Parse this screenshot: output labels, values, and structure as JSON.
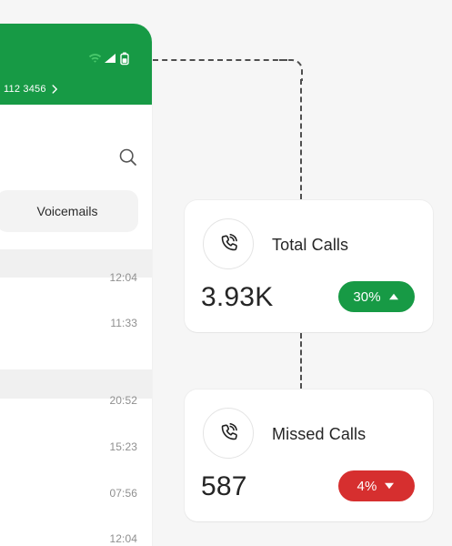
{
  "colors": {
    "background": "#f6f6f6",
    "panel": "#ffffff",
    "header_green": "#179a45",
    "success_green": "#179a45",
    "danger_red": "#d62f2f",
    "muted_text": "#8f8f8f",
    "connector": "#4f4f4f"
  },
  "phone": {
    "status_icons": [
      "wifi-icon",
      "signal-icon",
      "battery-icon"
    ],
    "account_number": "112 3456",
    "account_icon": "chevron-right-icon",
    "search_icon": "search-icon",
    "voicemails_label": "Voicemails",
    "times": [
      "12:04",
      "11:33",
      "20:52",
      "15:23",
      "07:56",
      "12:04"
    ]
  },
  "cards": {
    "total": {
      "icon": "phone-call-icon",
      "title": "Total Calls",
      "value": "3.93K",
      "badge": "30%",
      "trend_icon": "triangle-up-icon"
    },
    "missed": {
      "icon": "phone-call-icon",
      "title": "Missed Calls",
      "value": "587",
      "badge": "4%",
      "trend_icon": "triangle-down-icon"
    }
  }
}
